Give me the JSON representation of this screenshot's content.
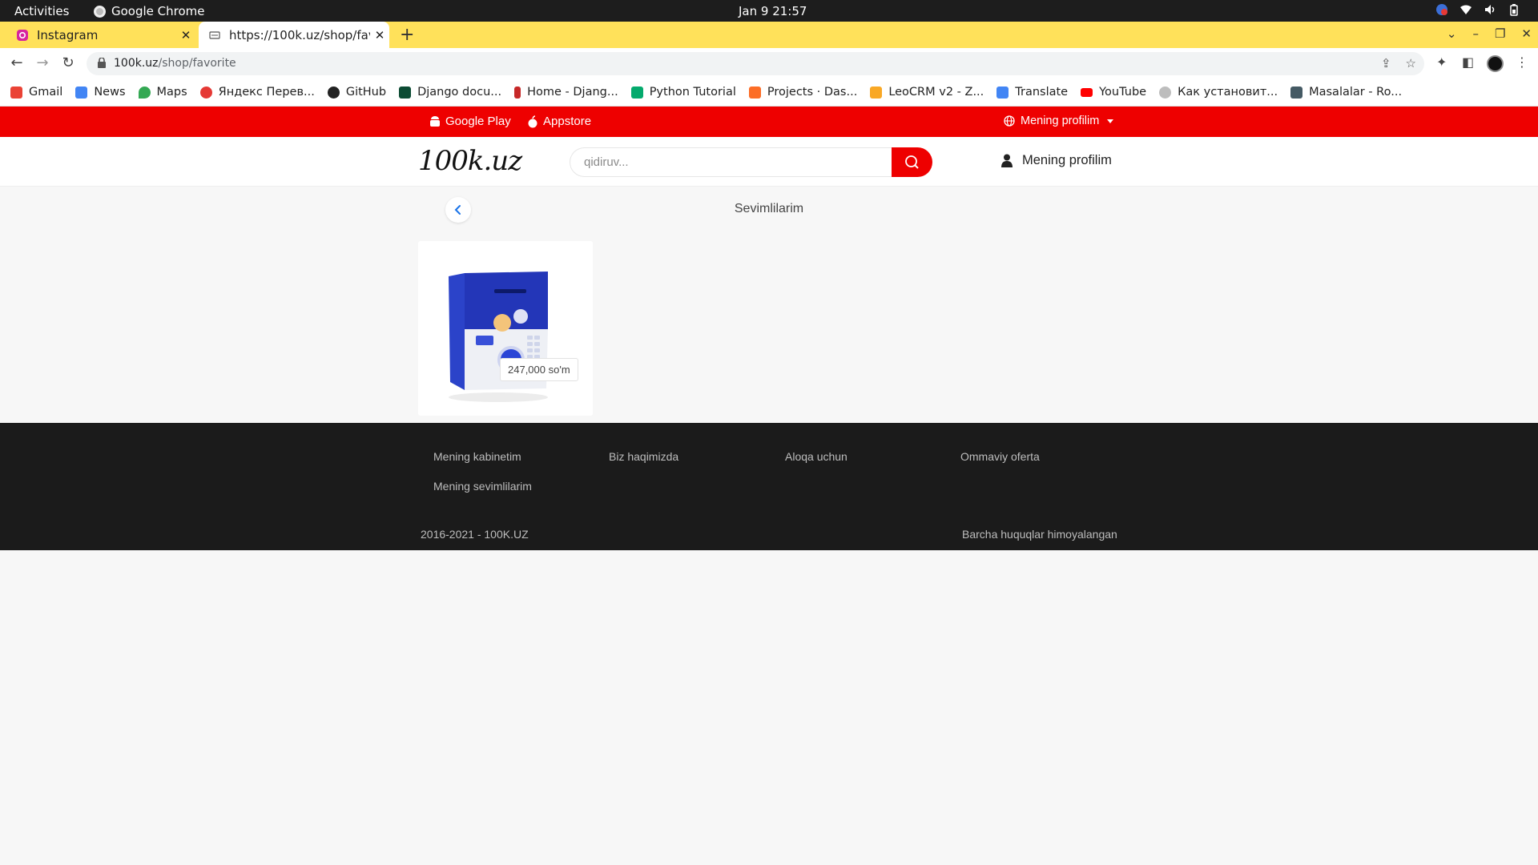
{
  "os": {
    "activities": "Activities",
    "app_name": "Google Chrome",
    "clock": "Jan 9  21:57"
  },
  "browser": {
    "tabs": [
      {
        "title": "Instagram",
        "favicon": "instagram-icon"
      },
      {
        "title": "https://100k.uz/shop/favorite",
        "favicon": "page-icon"
      }
    ],
    "url_host": "100k.uz",
    "url_path": "/shop/favorite",
    "bookmarks": [
      {
        "label": "Gmail",
        "icon": "gmail-icon",
        "color": "#ea4335"
      },
      {
        "label": "News",
        "icon": "news-icon",
        "color": "#4285f4"
      },
      {
        "label": "Maps",
        "icon": "maps-icon",
        "color": "#34a853"
      },
      {
        "label": "Яндекс Перев...",
        "icon": "yandex-translate-icon",
        "color": "#e53935"
      },
      {
        "label": "GitHub",
        "icon": "github-icon",
        "color": "#222222"
      },
      {
        "label": "Django docu...",
        "icon": "django-icon",
        "color": "#0c4b33"
      },
      {
        "label": "Home - Djang...",
        "icon": "bookmark-red-icon",
        "color": "#c62828"
      },
      {
        "label": "Python Tutorial",
        "icon": "w3schools-icon",
        "color": "#04aa6d"
      },
      {
        "label": "Projects · Das...",
        "icon": "gitlab-icon",
        "color": "#fc6d26"
      },
      {
        "label": "LeoCRM v2 - Z...",
        "icon": "leocrm-icon",
        "color": "#f9a825"
      },
      {
        "label": "Translate",
        "icon": "google-translate-icon",
        "color": "#4285f4"
      },
      {
        "label": "YouTube",
        "icon": "youtube-icon",
        "color": "#ff0000"
      },
      {
        "label": "Как установит...",
        "icon": "cloud-icon",
        "color": "#9e9e9e"
      },
      {
        "label": "Masalalar - Ro...",
        "icon": "robot-icon",
        "color": "#455a64"
      }
    ]
  },
  "site": {
    "promo": {
      "google_play": "Google Play",
      "appstore": "Appstore",
      "language_menu": "Mening profilim"
    },
    "logo": "100k.uz",
    "search_placeholder": "qidiruv...",
    "profile_label": "Mening profilim",
    "page_title": "Sevimlilarim",
    "products": [
      {
        "price": "247,000 so'm",
        "image": "piggy-bank-safe-blue-white"
      }
    ],
    "footer": {
      "links": [
        "Mening kabinetim",
        "Biz haqimizda",
        "Aloqa uchun",
        "Ommaviy oferta",
        "Mening sevimlilarim"
      ],
      "copyright": "2016-2021 - 100K.UZ",
      "rights": "Barcha huquqlar himoyalangan"
    },
    "colors": {
      "brand_red": "#ee0000",
      "footer_bg": "#1b1b1b",
      "tabstrip_yellow": "#ffe15a"
    }
  }
}
